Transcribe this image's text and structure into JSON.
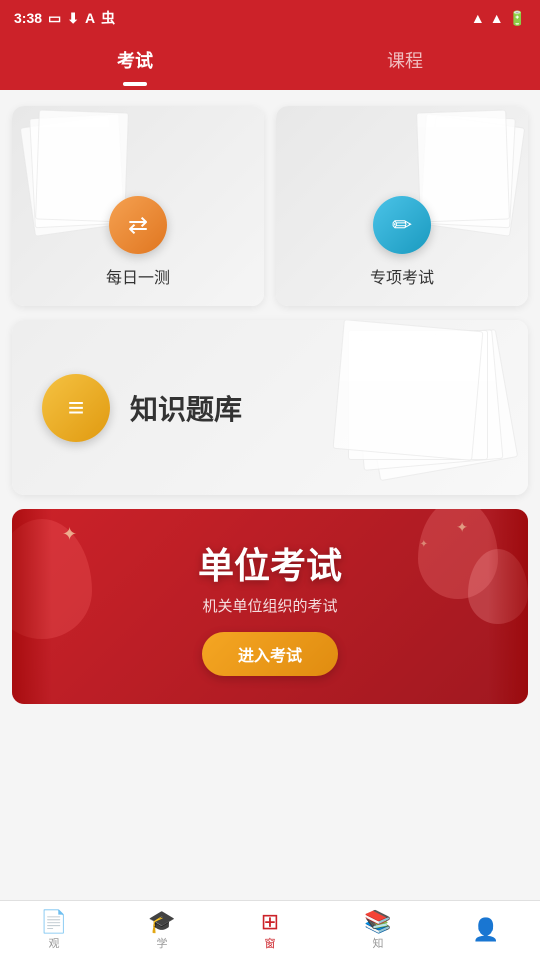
{
  "status_bar": {
    "time": "3:38",
    "icons": [
      "sim",
      "download",
      "text",
      "bug"
    ]
  },
  "header": {
    "tabs": [
      {
        "label": "考试",
        "active": true
      },
      {
        "label": "课程",
        "active": false
      }
    ]
  },
  "cards": {
    "daily_test": {
      "label": "每日一测",
      "icon_color": "#f5822a",
      "icon": "⇄"
    },
    "special_test": {
      "label": "专项考试",
      "icon_color": "#2bacd6",
      "icon": "✎"
    },
    "knowledge_bank": {
      "label": "知识题库",
      "icon_color": "#f5a623",
      "icon": "≡"
    },
    "unit_exam": {
      "title": "单位考试",
      "subtitle": "机关单位组织的考试",
      "btn_label": "进入考试"
    }
  },
  "bottom_nav": {
    "items": [
      {
        "label": "观",
        "icon": "doc",
        "active": false
      },
      {
        "label": "学",
        "icon": "grad",
        "active": false
      },
      {
        "label": "窗",
        "icon": "window",
        "active": true
      },
      {
        "label": "知",
        "icon": "book",
        "active": false
      },
      {
        "label": "",
        "icon": "user",
        "active": false
      }
    ]
  }
}
